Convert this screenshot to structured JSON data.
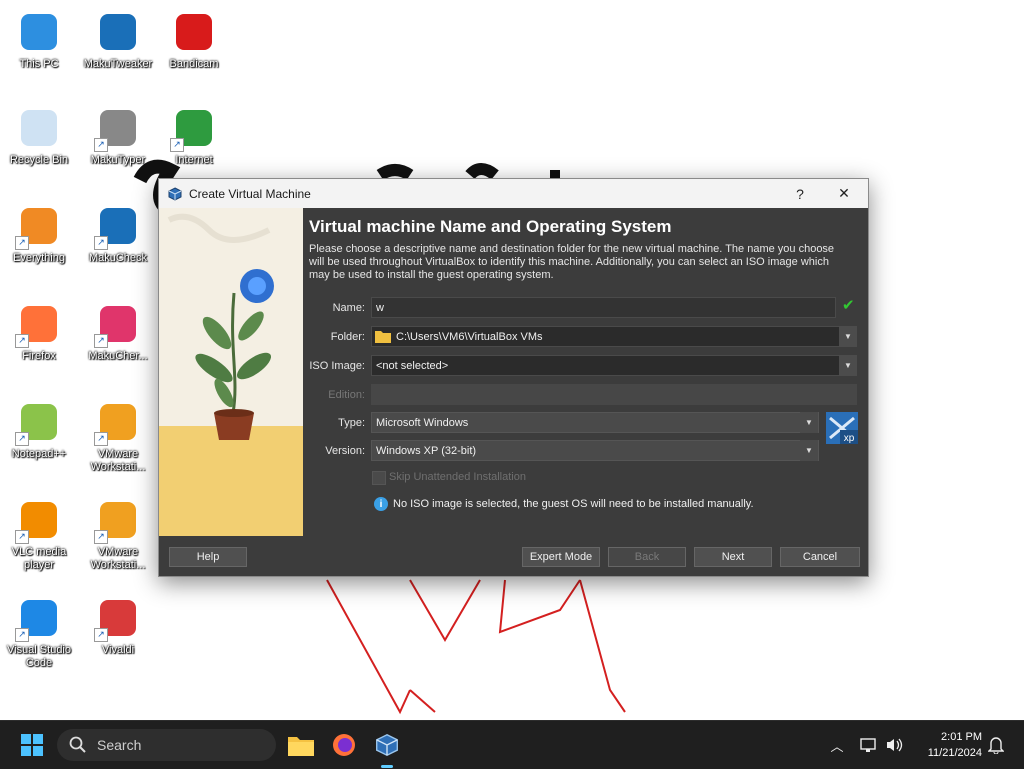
{
  "desktop": {
    "icons": [
      {
        "label": "This PC",
        "icon": "monitor-icon"
      },
      {
        "label": "MakuTweaker",
        "icon": "makutweaker-icon"
      },
      {
        "label": "Bandicam",
        "icon": "bandicam-icon"
      },
      {
        "label": "Recycle Bin",
        "icon": "recycle-bin-icon"
      },
      {
        "label": "MakuTyper",
        "icon": "makutyper-icon"
      },
      {
        "label": "Internet",
        "icon": "internet-download-icon"
      },
      {
        "label": "Everything",
        "icon": "everything-search-icon"
      },
      {
        "label": "MakuCheck",
        "icon": "makucheck-icon"
      },
      {
        "label": "Firefox",
        "icon": "firefox-icon"
      },
      {
        "label": "MakuCher...",
        "icon": "makucher-icon"
      },
      {
        "label": "Notepad++",
        "icon": "notepadpp-icon"
      },
      {
        "label": "VMware Workstati...",
        "icon": "vmware-icon"
      },
      {
        "label": "VLC media player",
        "icon": "vlc-icon"
      },
      {
        "label": "VMware Workstati...",
        "icon": "vmware-icon"
      },
      {
        "label": "Visual Studio Code",
        "icon": "vscode-icon"
      },
      {
        "label": "Vivaldi",
        "icon": "vivaldi-icon"
      }
    ]
  },
  "dialog": {
    "title": "Create Virtual Machine",
    "help_glyph": "?",
    "close_glyph": "✕",
    "heading": "Virtual machine Name and Operating System",
    "description": "Please choose a descriptive name and destination folder for the new virtual machine. The name you choose will be used throughout VirtualBox to identify this machine. Additionally, you can select an ISO image which may be used to install the guest operating system.",
    "fields": {
      "name_label": "Name:",
      "name_value": "w",
      "folder_label": "Folder:",
      "folder_value": "C:\\Users\\VM6\\VirtualBox VMs",
      "iso_label": "ISO Image:",
      "iso_value": "<not selected>",
      "edition_label": "Edition:",
      "edition_value": "",
      "type_label": "Type:",
      "type_value": "Microsoft Windows",
      "version_label": "Version:",
      "version_value": "Windows XP (32-bit)",
      "skip_unattended_label": "Skip Unattended Installation",
      "os_badge": "xp"
    },
    "info_text": "No ISO image is selected, the guest OS will need to be installed manually.",
    "buttons": {
      "help": "Help",
      "expert_mode": "Expert Mode",
      "back": "Back",
      "next": "Next",
      "cancel": "Cancel"
    }
  },
  "taskbar": {
    "search_placeholder": "Search",
    "time": "2:01 PM",
    "date": "11/21/2024"
  },
  "colors": {
    "dialog_bg": "#3c3c3c",
    "taskbar_bg": "#1f1f1f",
    "accent_check": "#32c832",
    "info_blue": "#3aa0e6"
  }
}
